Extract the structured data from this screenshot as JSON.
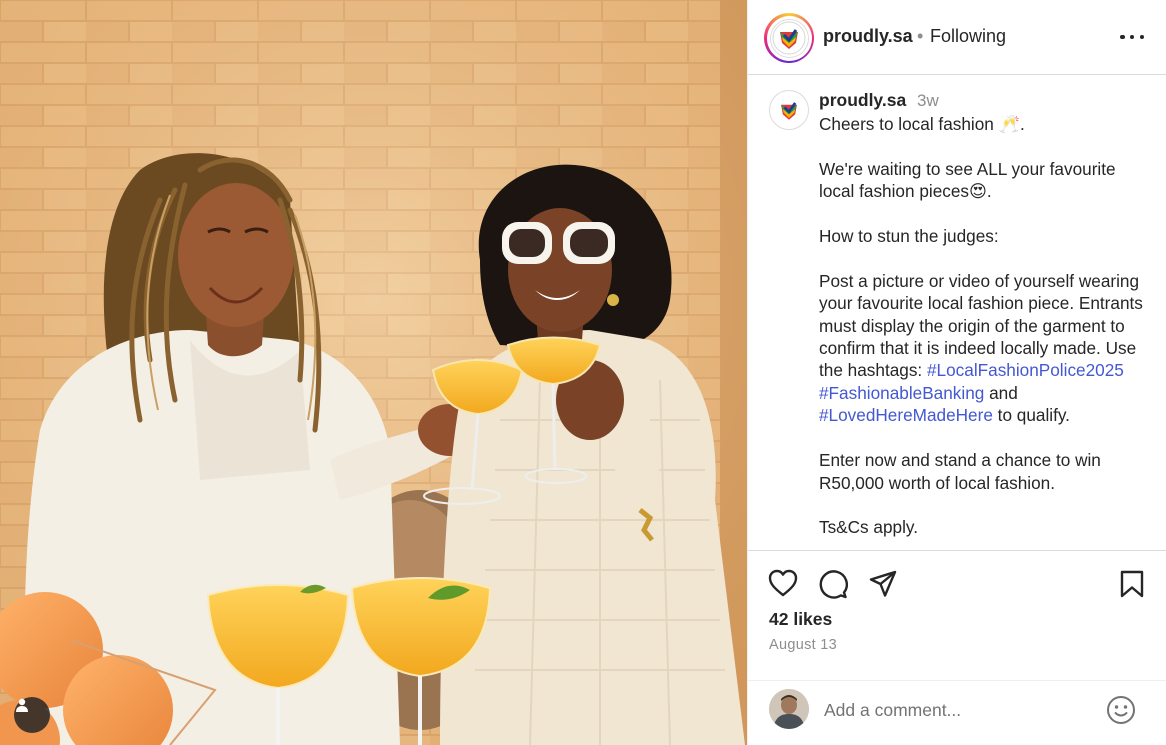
{
  "header": {
    "username": "proudly.sa",
    "separator": "•",
    "follow_status": "Following"
  },
  "caption": {
    "username": "proudly.sa",
    "time_ago": "3w",
    "line_1": "Cheers to local fashion 🥂.",
    "line_2": "We're waiting to see ALL your favourite local fashion pieces😍.",
    "line_3": "How to stun the judges:",
    "line_4": "Post a picture or video of yourself wearing your favourite local fashion piece. Entrants must display the origin of the garment to confirm that it is indeed locally made. Use the hashtags: ",
    "hashtag_1": "#LocalFashionPolice2025",
    "hashtag_2": "#FashionableBanking",
    "and_text": " and ",
    "hashtag_3": "#LovedHereMadeHere",
    "qualify_text": " to qualify.",
    "line_5": "Enter now and stand a chance to win R50,000 worth of local fashion.",
    "line_6": "Ts&Cs apply."
  },
  "stats": {
    "likes": "42 likes",
    "date": "August 13"
  },
  "comment": {
    "placeholder": "Add a comment..."
  },
  "icons": [
    "user-tag-icon",
    "more-options-icon",
    "like-icon",
    "comment-icon",
    "share-icon",
    "save-icon",
    "emoji-icon"
  ],
  "colors": {
    "hashtag": "#4458d1",
    "text": "#262626",
    "secondary": "#8e8e8e",
    "border": "#dbdbdb"
  }
}
